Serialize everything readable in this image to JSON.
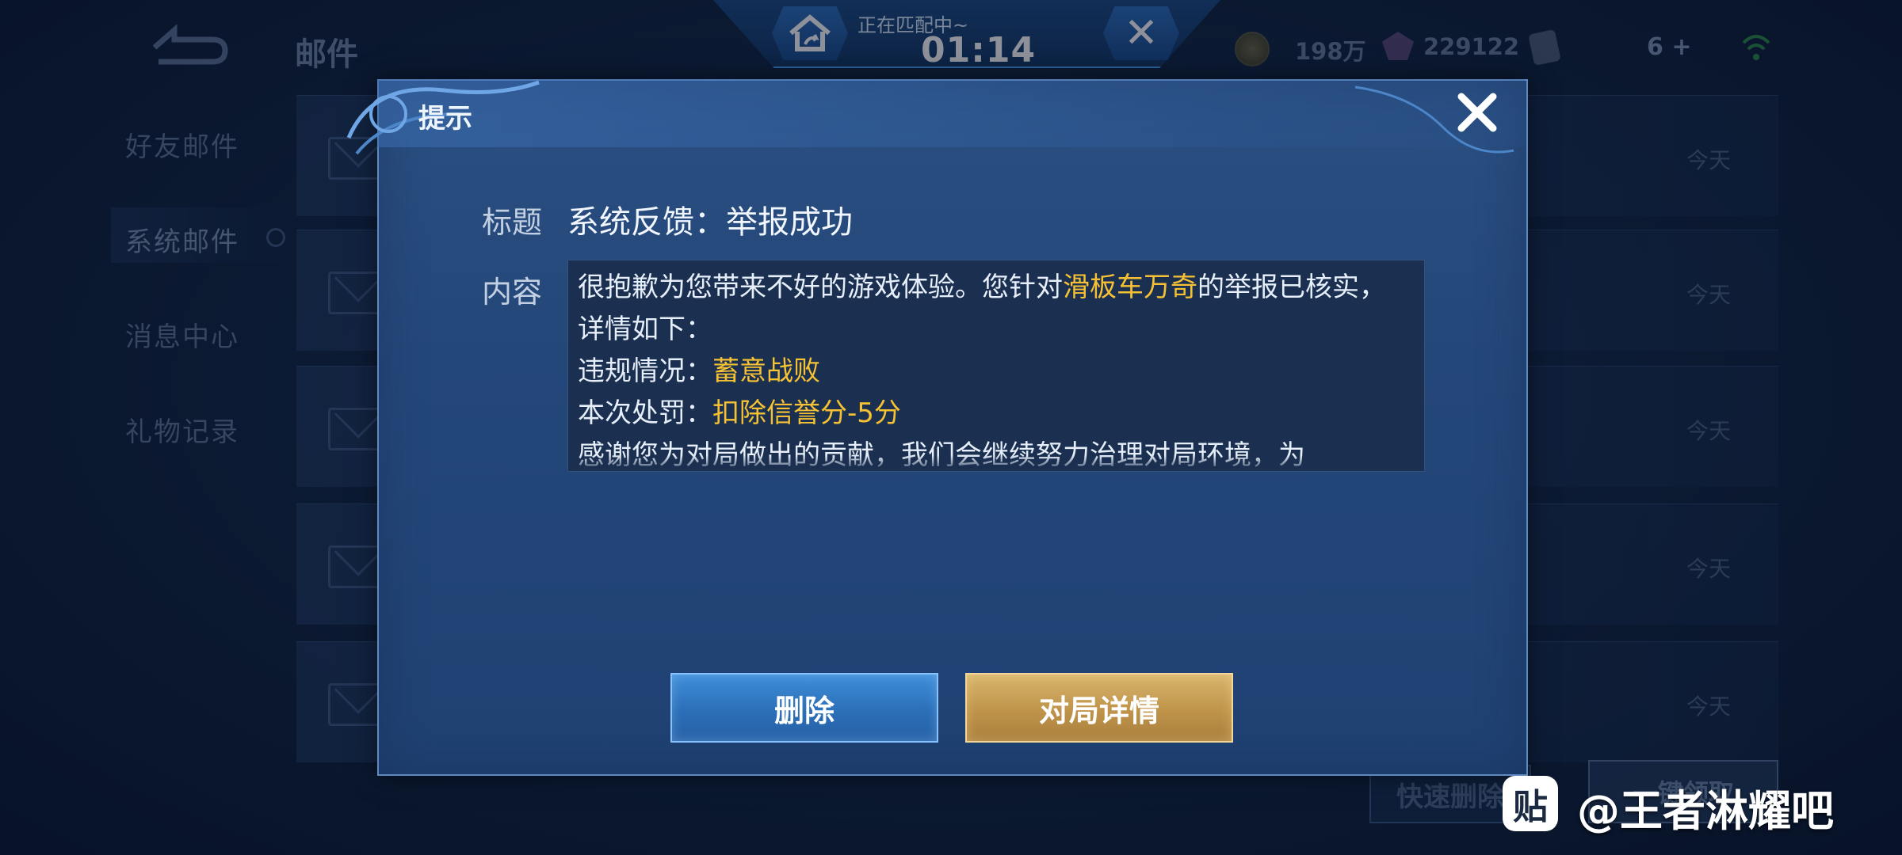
{
  "page": {
    "title": "邮件"
  },
  "sidebar": {
    "items": [
      {
        "label": "好友邮件"
      },
      {
        "label": "系统邮件"
      },
      {
        "label": "消息中心"
      },
      {
        "label": "礼物记录"
      }
    ]
  },
  "mail_list": {
    "dates": [
      "今天",
      "今天",
      "今天",
      "今天",
      "今天"
    ],
    "quick_delete_label": "快速删除",
    "one_key_label": "一键领取"
  },
  "topbar": {
    "matching_text": "正在匹配中~",
    "timer": "01:14",
    "gold": "198万",
    "diamonds": "229122",
    "extra_count": "6"
  },
  "dialog": {
    "title": "提示",
    "subject_label": "标题",
    "subject_value": "系统反馈：举报成功",
    "content_label": "内容",
    "content": {
      "line1_a": "很抱歉为您带来不好的游戏体验。您针对",
      "player": "滑板车万奇",
      "line1_b": "的举报已核实，详情如下：",
      "violation_label": "违规情况：",
      "violation_value": "蓄意战败",
      "penalty_label": "本次处罚：",
      "penalty_value": "扣除信誉分-5分",
      "line4": "感谢您为对局做出的贡献，我们会继续努力治理对局环境，为"
    },
    "delete_button": "删除",
    "details_button": "对局详情"
  },
  "watermark": {
    "icon": "贴",
    "text": "@王者淋耀吧"
  },
  "colors": {
    "highlight": "#f6c233",
    "dialog_bg": "#24477a",
    "delete_btn": "#2b6fb8",
    "details_btn": "#bf934a"
  }
}
